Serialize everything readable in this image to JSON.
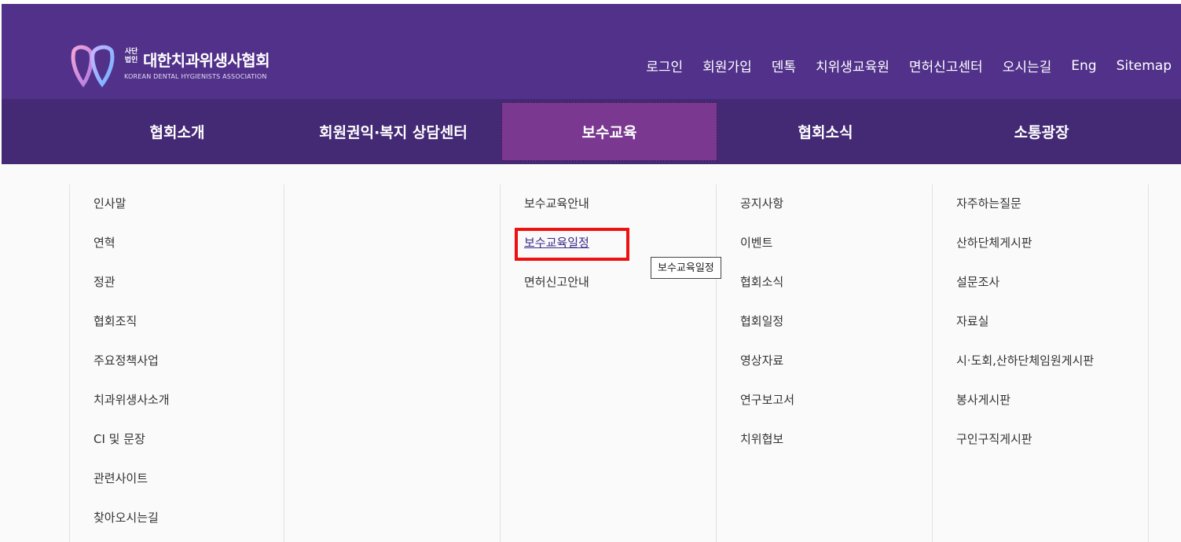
{
  "header": {
    "logo_badge_line1": "사단",
    "logo_badge_line2": "법인",
    "logo_name": "대한치과위생사협회",
    "logo_english": "KOREAN DENTAL HYGIENISTS ASSOCIATION",
    "util_links": [
      "로그인",
      "회원가입",
      "덴톡",
      "치위생교육원",
      "면허신고센터",
      "오시는길",
      "Eng",
      "Sitemap"
    ]
  },
  "gnb": {
    "items": [
      "협회소개",
      "회원권익·복지 상담센터",
      "보수교육",
      "협회소식",
      "소통광장"
    ],
    "active_index": 2
  },
  "submenu": {
    "col1": [
      "인사말",
      "연혁",
      "정관",
      "협회조직",
      "주요정책사업",
      "치과위생사소개",
      "CI 및 문장",
      "관련사이트",
      "찾아오시는길"
    ],
    "col2": [],
    "col3": [
      "보수교육안내",
      "보수교육일정",
      "면허신고안내"
    ],
    "col4": [
      "공지사항",
      "이벤트",
      "협회소식",
      "협회일정",
      "영상자료",
      "연구보고서",
      "치위협보"
    ],
    "col5": [
      "자주하는질문",
      "산하단체게시판",
      "설문조사",
      "자료실",
      "시·도회,산하단체임원게시판",
      "봉사게시판",
      "구인구직게시판"
    ]
  },
  "tooltip": {
    "text": "보수교육일정"
  },
  "colors": {
    "header_bg": "#51318a",
    "gnb_bg": "#442a75",
    "gnb_active_bg": "#7a3890",
    "highlight": "#ee1111"
  }
}
